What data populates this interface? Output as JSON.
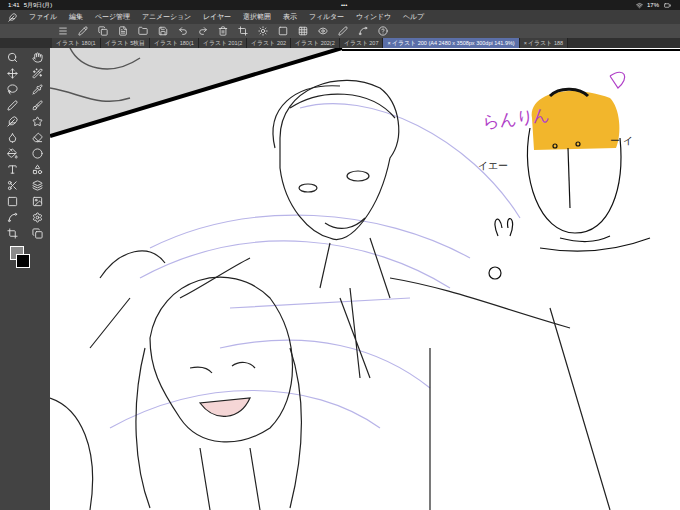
{
  "status_bar": {
    "time": "1:41",
    "date": "5月9日(月)",
    "dots": "•••",
    "battery": "17%"
  },
  "menu": [
    "ファイル",
    "編集",
    "ページ管理",
    "アニメーション",
    "レイヤー",
    "選択範囲",
    "表示",
    "フィルター",
    "ウィンドウ",
    "ヘルプ"
  ],
  "tabs": [
    {
      "label": "イラスト 180(1",
      "selected": false
    },
    {
      "label": "イラスト 5枚目",
      "selected": false
    },
    {
      "label": "イラスト 180(1",
      "selected": false
    },
    {
      "label": "イラスト 201(2",
      "selected": false
    },
    {
      "label": "イラスト 202",
      "selected": false
    },
    {
      "label": "イラスト 202(2",
      "selected": false
    },
    {
      "label": "イラスト 207",
      "selected": false
    },
    {
      "label": "× イラスト 200 (A4 2480 x 3508px 300dpi 141.9%)",
      "selected": true
    },
    {
      "label": "× イラスト 188",
      "selected": false
    }
  ],
  "canvas_annotations": [
    {
      "text": "らんりん",
      "color": "#b040c8"
    },
    {
      "text": "イエー",
      "color": "#222222"
    },
    {
      "text": "ー イ",
      "color": "#222222"
    }
  ]
}
